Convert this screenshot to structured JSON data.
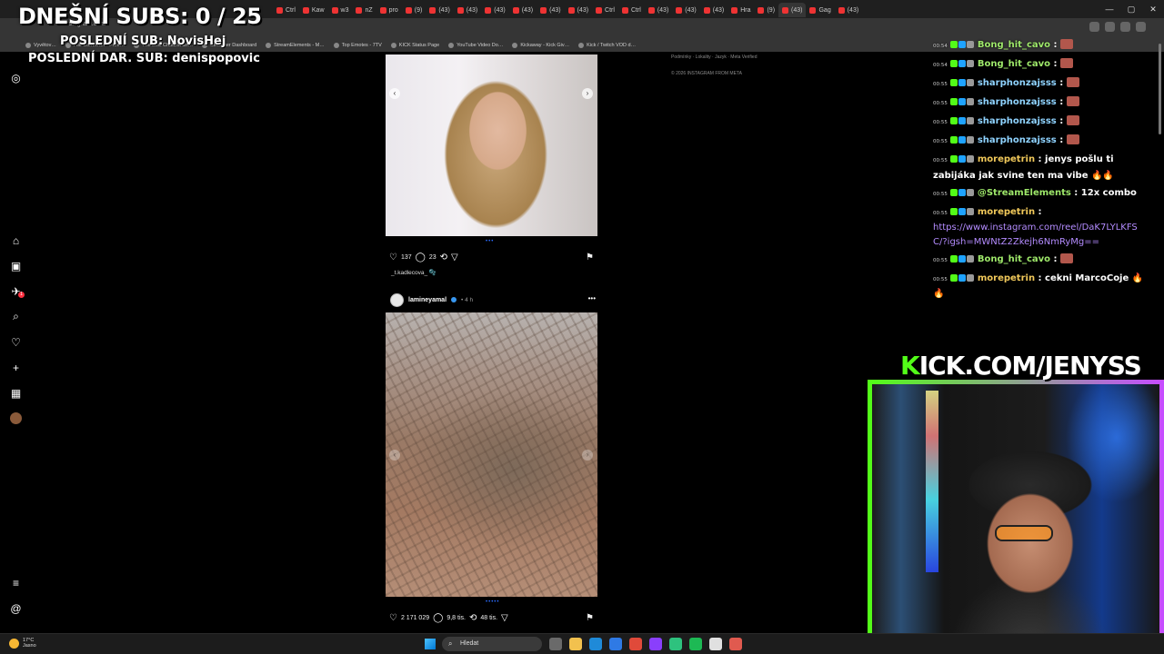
{
  "browser": {
    "url": "instagram.com",
    "tabs": [
      "Ctrl",
      "Kaw",
      "w3",
      "nZ",
      "pro",
      "(9)",
      "(43)",
      "(43)",
      "(43)",
      "(43)",
      "(43)",
      "(43)",
      "Ctrl",
      "Ctrl",
      "(43)",
      "(43)",
      "(43)",
      "Hra",
      "(9)",
      "(43)",
      "Gag",
      "(43)"
    ],
    "active_tab_index": 19,
    "bookmarks": [
      "Vyvětov…",
      "File Converter - Free…",
      "The best ChatBot an…",
      "Streamer Dashboard",
      "StreamElements - M…",
      "Top Emotes - 7TV",
      "KICK Status Page",
      "YouTube Video Do…",
      "Kickaway - Kick Giv…",
      "Kick / Twitch VOD d…"
    ],
    "window_controls": [
      "—",
      "▢",
      "✕"
    ]
  },
  "overlay": {
    "subs_goal": "DNEŠNÍ SUBS: 0 / 25",
    "last_sub": "POSLEDNÍ SUB: NovisHej",
    "last_donation": "POSLEDNÍ DAR. SUB: denispopovic",
    "kick_url_prefix": "K",
    "kick_url_rest": "ICK.COM/JENYSS"
  },
  "instagram": {
    "nav_icons": [
      "instagram-icon",
      "home-icon",
      "reels-icon",
      "messages-icon",
      "search-icon",
      "notifications-icon",
      "create-icon",
      "dashboard-icon",
      "profile-icon",
      "menu-icon",
      "threads-icon"
    ],
    "notification_badge": "1",
    "post1": {
      "likes": "137",
      "comments": "23",
      "caption": "_t.kadlecova_ 🫧"
    },
    "post2": {
      "username": "lamineyamal",
      "time": "• 4 h",
      "likes": "2 171 029",
      "comments": "9,8 tis.",
      "reposts": "48 tis."
    },
    "footer": {
      "links": "Podmínky · Lokality · Jazyk · Meta Verified",
      "copyright": "© 2026 INSTAGRAM FROM META"
    }
  },
  "chat": {
    "messages": [
      {
        "time": "00:54",
        "user": "Bong_hit_cavo",
        "text": ""
      },
      {
        "time": "00:54",
        "user": "Bong_hit_cavo",
        "text": ""
      },
      {
        "time": "00:55",
        "user": "sharphonzajsss",
        "text": ""
      },
      {
        "time": "00:55",
        "user": "sharphonzajsss",
        "text": ""
      },
      {
        "time": "00:55",
        "user": "sharphonzajsss",
        "text": ""
      },
      {
        "time": "00:55",
        "user": "sharphonzajsss",
        "text": ""
      },
      {
        "time": "00:55",
        "user": "morepetrin",
        "text": "jenys pošlu ti zabijáka jak svine ten ma vibe"
      },
      {
        "time": "00:55",
        "user": "@StreamElements",
        "text": "12x combo"
      },
      {
        "time": "00:55",
        "user": "morepetrin",
        "text": ""
      },
      {
        "time": "00:55",
        "user": "Bong_hit_cavo",
        "text": ""
      },
      {
        "time": "00:55",
        "user": "morepetrin",
        "text": "cekni MarcoCoje"
      }
    ],
    "link": "https://www.instagram.com/reel/DaK7LYLKFSC/?igsh=MWNtZ2Zkejh6NmRyMg=="
  },
  "taskbar": {
    "temperature": "17°C",
    "weather": "Jasno",
    "search_placeholder": "Hledat",
    "app_colors": [
      "#6a6a6a",
      "#f2c14e",
      "#1f8ad8",
      "#2f7ae5",
      "#e04a3a",
      "#8a3ffc",
      "#2ec27e",
      "#1db954",
      "#e0e0e0",
      "#e05a4f"
    ]
  }
}
